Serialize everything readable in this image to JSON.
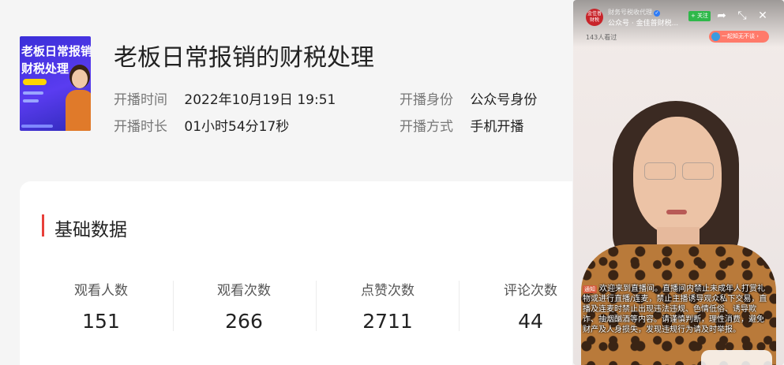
{
  "header": {
    "cover_line1": "老板日常报销",
    "cover_line2": "财税处理",
    "title": "老板日常报销的财税处理",
    "start_time_label": "开播时间",
    "start_time_value": "2022年10月19日 19:51",
    "duration_label": "开播时长",
    "duration_value": "01小时54分17秒",
    "identity_label": "开播身份",
    "identity_value": "公众号身份",
    "method_label": "开播方式",
    "method_value": "手机开播"
  },
  "basic_data": {
    "title": "基础数据",
    "stats": [
      {
        "label": "观看人数",
        "value": "151"
      },
      {
        "label": "观看次数",
        "value": "266"
      },
      {
        "label": "点赞次数",
        "value": "2711"
      },
      {
        "label": "评论次数",
        "value": "44"
      }
    ]
  },
  "video": {
    "avatar_text": "金佳普财税",
    "account_small": "财务号税收代理",
    "account_name": "公众号 · 金佳普财税...",
    "follow_label": "+ 关注",
    "viewers": "143人看过",
    "pill_label": "一起知无不谈 ›",
    "notice_tag": "通知",
    "notice_text": "欢迎来到直播间。直播间内禁止未成年人打赏礼物或进行直播/连麦，禁止主播诱导观众私下交易，直播及连麦时禁止出现违法违规、色情低俗、诱导欺诈、抽烟酗酒等内容。请谨慎判断，理性消费，避免财产及人身损失，发现违规行为请及时举报。",
    "icons": [
      "share-icon",
      "shrink-icon",
      "close-icon"
    ]
  }
}
